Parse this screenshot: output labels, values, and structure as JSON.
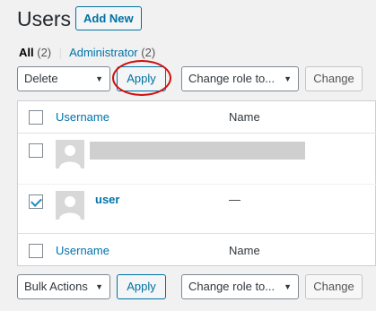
{
  "header": {
    "title": "Users",
    "add_new": "Add New"
  },
  "filters": {
    "all_label": "All",
    "all_count": "(2)",
    "separator": "|",
    "admin_label": "Administrator",
    "admin_count": "(2)"
  },
  "top_controls": {
    "bulk_select": "Delete",
    "apply": "Apply",
    "role_select": "Change role to...",
    "change": "Change"
  },
  "bottom_controls": {
    "bulk_select": "Bulk Actions",
    "apply": "Apply",
    "role_select": "Change role to...",
    "change": "Change"
  },
  "table": {
    "col_username": "Username",
    "col_name": "Name",
    "rows": [
      {
        "username": "",
        "name": "",
        "checked": false,
        "redacted": true
      },
      {
        "username": "user",
        "name": "—",
        "checked": true,
        "redacted": false
      }
    ]
  },
  "colors": {
    "accent": "#0073aa",
    "annotation": "#d10d0d"
  },
  "icons": {
    "dropdown": "chevron-down-icon",
    "avatar": "default-avatar-icon"
  }
}
